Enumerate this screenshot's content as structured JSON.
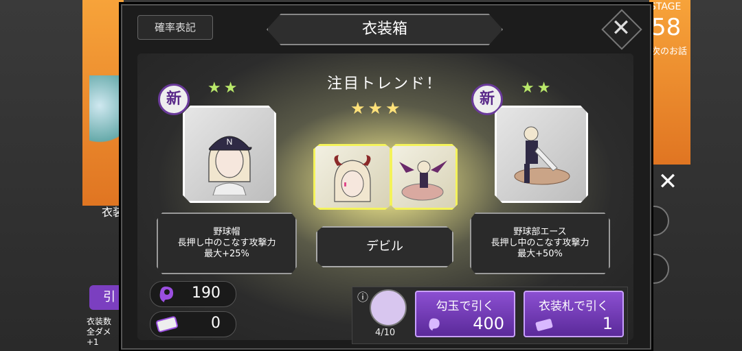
{
  "background": {
    "stage_label": "STAGE",
    "stage_number": "58",
    "next_story": "次のお話",
    "left_label": "衣装",
    "left_button": "引",
    "left_info_lines": [
      "衣装数",
      "全ダメ",
      "+1"
    ]
  },
  "modal": {
    "title": "衣装箱",
    "rate_button": "確率表記",
    "trend_title": "注目トレンド！"
  },
  "costumes": [
    {
      "name": "野球帽",
      "line2": "長押し中のこなす攻撃力",
      "line3": "最大+25%",
      "stars": "★★",
      "is_new": true,
      "new_label": "新"
    },
    {
      "name": "デビル",
      "stars": "★★★",
      "is_new": false
    },
    {
      "name": "野球部エース",
      "line2": "長押し中のこなす攻撃力",
      "line3": "最大+50%",
      "stars": "★★",
      "is_new": true,
      "new_label": "新"
    }
  ],
  "currencies": {
    "magatama": "190",
    "costume_tickets": "0"
  },
  "gacha": {
    "info_icon": "ⓘ",
    "progress": "4/10",
    "pull_magatama_label": "勾玉で引く",
    "pull_magatama_cost": "400",
    "pull_ticket_label": "衣装札で引く",
    "pull_ticket_cost": "1"
  },
  "colors": {
    "accent_purple": "#7b3fc0",
    "star_green": "#b9e86a",
    "star_gold": "#ffe27a",
    "highlight_yellow": "#f4f35a"
  }
}
